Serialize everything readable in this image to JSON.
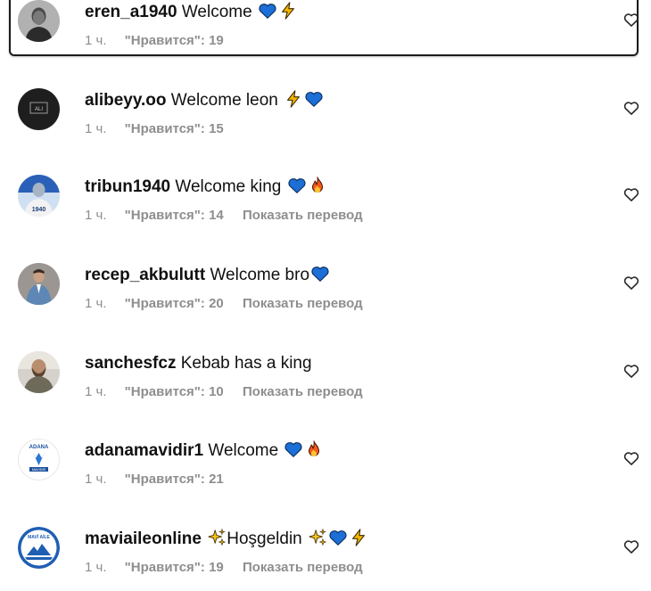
{
  "colors": {
    "text": "#111111",
    "meta": "#8e8e8e",
    "heart_blue": "#1c6fd6",
    "bolt": "#f7b500",
    "fire": "#f25a1c",
    "sparkle": "#f9c51e"
  },
  "comments": [
    {
      "username": "eren_a1940",
      "text": "Welcome",
      "emojis": [
        "blue-heart",
        "lightning"
      ],
      "time": "1 ч.",
      "likes": "\"Нравится\": 19",
      "translate": "",
      "avatar": "avatar-eren"
    },
    {
      "username": "alibeyy.oo",
      "text": "Welcome leon",
      "emojis": [
        "lightning",
        "blue-heart"
      ],
      "time": "1 ч.",
      "likes": "\"Нравится\": 15",
      "translate": "",
      "avatar": "avatar-alibeyy"
    },
    {
      "username": "tribun1940",
      "text": "Welcome king",
      "emojis": [
        "blue-heart",
        "fire"
      ],
      "time": "1 ч.",
      "likes": "\"Нравится\": 14",
      "translate": "Показать перевод",
      "avatar": "avatar-tribun"
    },
    {
      "username": "recep_akbulutt",
      "text": "Welcome bro",
      "emojis": [
        "blue-heart"
      ],
      "time": "1 ч.",
      "likes": "\"Нравится\": 20",
      "translate": "Показать перевод",
      "avatar": "avatar-recep"
    },
    {
      "username": "sanchesfcz",
      "text": "Kebab has a king",
      "emojis": [],
      "time": "1 ч.",
      "likes": "\"Нравится\": 10",
      "translate": "Показать перевод",
      "avatar": "avatar-sanches"
    },
    {
      "username": "adanamavidir1",
      "text": "Welcome",
      "emojis": [
        "blue-heart",
        "fire"
      ],
      "time": "1 ч.",
      "likes": "\"Нравится\": 21",
      "translate": "",
      "avatar": "avatar-adana"
    },
    {
      "username": "maviaileonline",
      "text": "Hoşgeldin",
      "emojis_before": [
        "sparkles"
      ],
      "emojis": [
        "sparkles",
        "blue-heart",
        "lightning"
      ],
      "time": "1 ч.",
      "likes": "\"Нравится\": 19",
      "translate": "Показать перевод",
      "avatar": "avatar-maviaile"
    }
  ]
}
